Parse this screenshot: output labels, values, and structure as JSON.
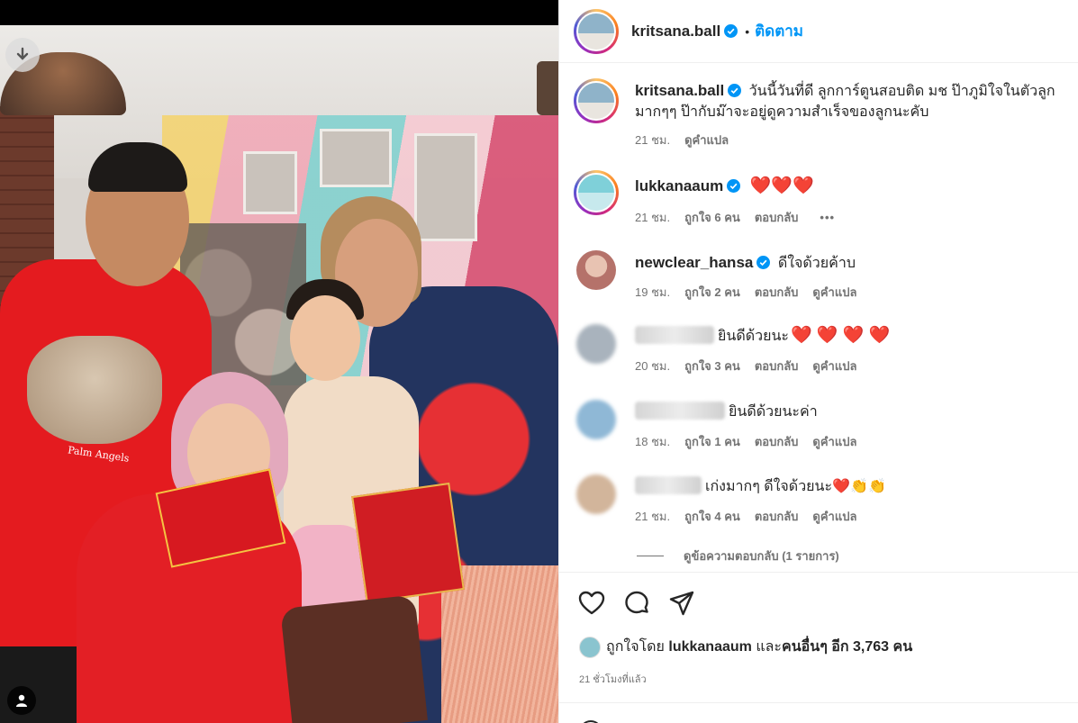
{
  "post": {
    "author": "kritsana.ball",
    "follow_label": "ติดตาม",
    "separator": "•",
    "caption": "วันนี้วันที่ดี ลูกการ์ตูนสอบติด มช ป๊าภูมิใจในตัวลูกมากๆๆ ป๊ากับม๊าจะอยู่ดูความสำเร็จของลูกนะคับ",
    "caption_time": "21 ชม.",
    "translate_label": "ดูคำแปล",
    "shirt_print": "Palm Angels"
  },
  "comments": [
    {
      "user": "lukkanaaum",
      "text": "❤️❤️❤️",
      "time": "21 ชม.",
      "likes": "ถูกใจ 6 คน",
      "reply": "ตอบกลับ",
      "more": "•••"
    },
    {
      "user": "newclear_hansa",
      "text": "ดีใจด้วยค้าบ",
      "time": "19 ชม.",
      "likes": "ถูกใจ 2 คน",
      "reply": "ตอบกลับ",
      "translate": "ดูคำแปล"
    },
    {
      "text": "ยินดีด้วยนะ",
      "hearts": "❤️ ❤️ ❤️ ❤️",
      "time": "20 ชม.",
      "likes": "ถูกใจ 3 คน",
      "reply": "ตอบกลับ",
      "translate": "ดูคำแปล"
    },
    {
      "text": "ยินดีด้วยนะค่า",
      "time": "18 ชม.",
      "likes": "ถูกใจ 1 คน",
      "reply": "ตอบกลับ",
      "translate": "ดูคำแปล"
    },
    {
      "text": "เก่งมากๆ ดีใจด้วยนะ",
      "emojis": "❤️👏👏",
      "time": "21 ชม.",
      "likes": "ถูกใจ 4 คน",
      "reply": "ตอบกลับ",
      "translate": "ดูคำแปล"
    }
  ],
  "view_replies": "ดูข้อความตอบกลับ (1 รายการ)",
  "likes": {
    "prefix": "ถูกใจโดย",
    "user": "lukkanaaum",
    "mid": "และ",
    "others": "คนอื่นๆ",
    "count_text": "อีก 3,763 คน"
  },
  "time_ago": "21 ชั่วโมงที่แล้ว",
  "icons": {
    "download": "download-icon",
    "user": "user-icon",
    "like": "heart-icon",
    "comment": "comment-icon",
    "share": "share-icon",
    "verified": "verified-badge-icon"
  },
  "colors": {
    "link_blue": "#0095f6",
    "verified_blue": "#0095f6",
    "meta_gray": "#737373"
  }
}
